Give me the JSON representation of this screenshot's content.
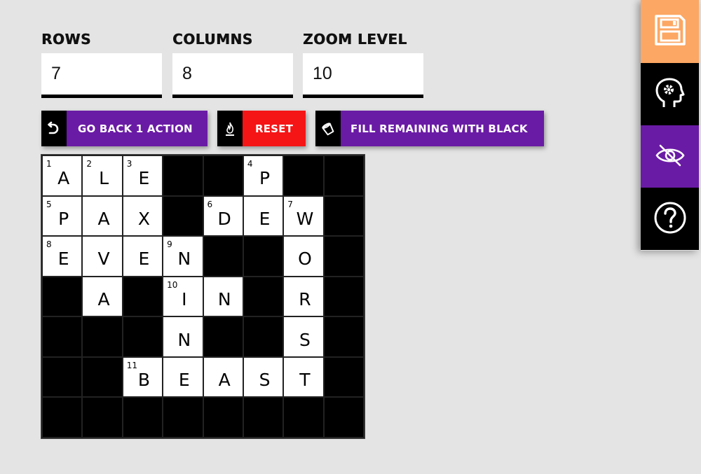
{
  "fields": {
    "rows": {
      "label": "ROWS",
      "value": "7"
    },
    "columns": {
      "label": "COLUMNS",
      "value": "8"
    },
    "zoom": {
      "label": "ZOOM LEVEL",
      "value": "10"
    }
  },
  "buttons": {
    "go_back": {
      "label": "GO BACK 1 ACTION",
      "icon": "undo-icon"
    },
    "reset": {
      "label": "RESET",
      "icon": "fire-icon"
    },
    "fill_black": {
      "label": "FILL REMAINING WITH BLACK",
      "icon": "paint-bucket-icon"
    }
  },
  "sidebar": [
    {
      "name": "save",
      "icon": "floppy-disk-icon"
    },
    {
      "name": "settings-brain",
      "icon": "head-gear-icon"
    },
    {
      "name": "toggle-visibility",
      "icon": "eye-slash-icon"
    },
    {
      "name": "help",
      "icon": "question-circle-icon"
    }
  ],
  "colors": {
    "purple": "#6a1ba5",
    "red": "#f51516",
    "orange": "#fca763",
    "background": "#e4e4e4"
  },
  "puzzle": {
    "rows": 7,
    "cols": 8,
    "grid": [
      [
        {
          "n": "1",
          "l": "A"
        },
        {
          "n": "2",
          "l": "L"
        },
        {
          "n": "3",
          "l": "E"
        },
        null,
        null,
        {
          "n": "4",
          "l": "P"
        },
        null,
        null
      ],
      [
        {
          "n": "5",
          "l": "P"
        },
        {
          "n": "",
          "l": "A"
        },
        {
          "n": "",
          "l": "X"
        },
        null,
        {
          "n": "6",
          "l": "D"
        },
        {
          "n": "",
          "l": "E"
        },
        {
          "n": "7",
          "l": "W"
        },
        null
      ],
      [
        {
          "n": "8",
          "l": "E"
        },
        {
          "n": "",
          "l": "V"
        },
        {
          "n": "",
          "l": "E"
        },
        {
          "n": "9",
          "l": "N"
        },
        null,
        null,
        {
          "n": "",
          "l": "O"
        },
        null
      ],
      [
        null,
        {
          "n": "",
          "l": "A"
        },
        null,
        {
          "n": "10",
          "l": "I"
        },
        {
          "n": "",
          "l": "N"
        },
        null,
        {
          "n": "",
          "l": "R"
        },
        null
      ],
      [
        null,
        null,
        null,
        {
          "n": "",
          "l": "N"
        },
        null,
        null,
        {
          "n": "",
          "l": "S"
        },
        null
      ],
      [
        null,
        null,
        {
          "n": "11",
          "l": "B"
        },
        {
          "n": "",
          "l": "E"
        },
        {
          "n": "",
          "l": "A"
        },
        {
          "n": "",
          "l": "S"
        },
        {
          "n": "",
          "l": "T"
        },
        null
      ],
      [
        null,
        null,
        null,
        null,
        null,
        null,
        null,
        null
      ]
    ]
  }
}
